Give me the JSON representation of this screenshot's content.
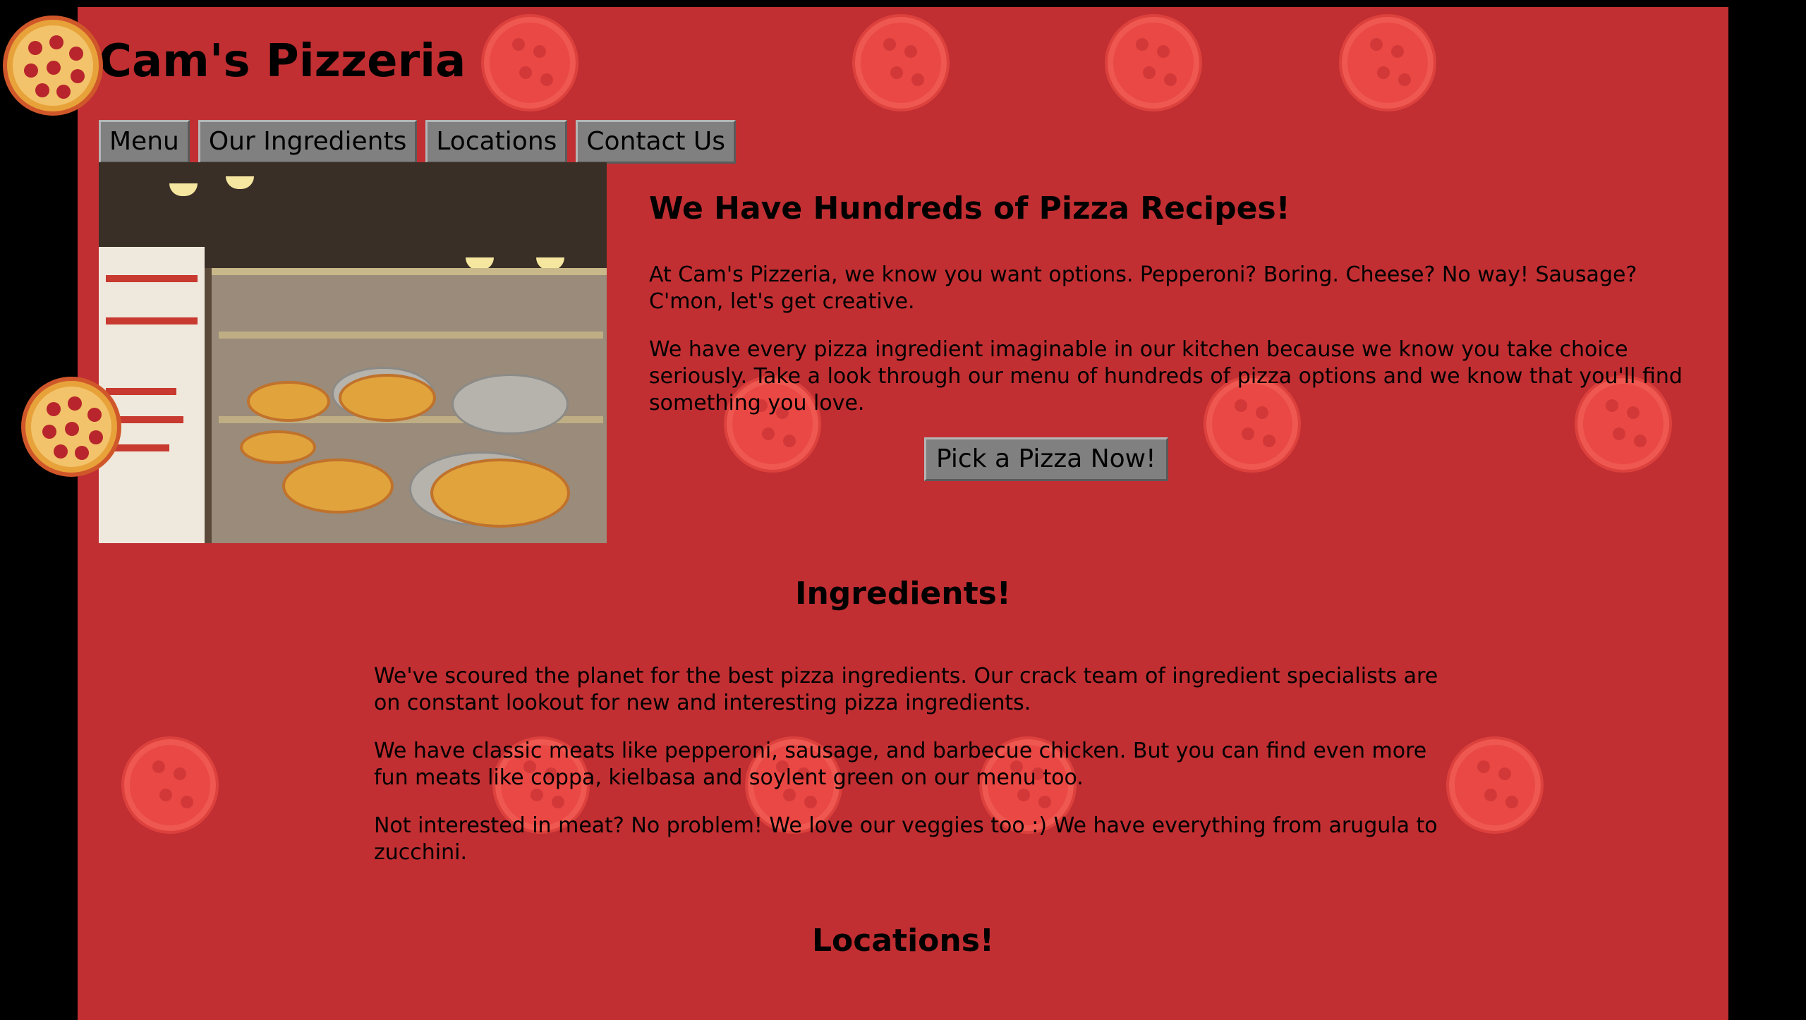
{
  "site": {
    "title": "Cam's Pizzeria"
  },
  "nav": [
    "Menu",
    "Our Ingredients",
    "Locations",
    "Contact Us"
  ],
  "hero": {
    "heading": "We Have Hundreds of Pizza Recipes!",
    "paragraphs": [
      "At Cam's Pizzeria, we know you want options. Pepperoni? Boring. Cheese? No way! Sausage? C'mon, let's get creative.",
      "We have every pizza ingredient imaginable in our kitchen because we know you take choice seriously. Take a look through our menu of hundreds of pizza options and we know that you'll find something you love."
    ],
    "cta_label": "Pick a Pizza Now!"
  },
  "ingredients": {
    "heading": "Ingredients!",
    "paragraphs": [
      "We've scoured the planet for the best pizza ingredients. Our crack team of ingredient specialists are on constant lookout for new and interesting pizza ingredients.",
      "We have classic meats like pepperoni, sausage, and barbecue chicken. But you can find even more fun meats like coppa, kielbasa and soylent green on our menu too.",
      "Not interested in meat? No problem! We love our veggies too :) We have everything from arugula to zucchini."
    ]
  },
  "locations": {
    "heading": "Locations!"
  },
  "colors": {
    "page_bg": "#c12f32",
    "outer_bg": "#000000",
    "button_bg": "#808080"
  }
}
